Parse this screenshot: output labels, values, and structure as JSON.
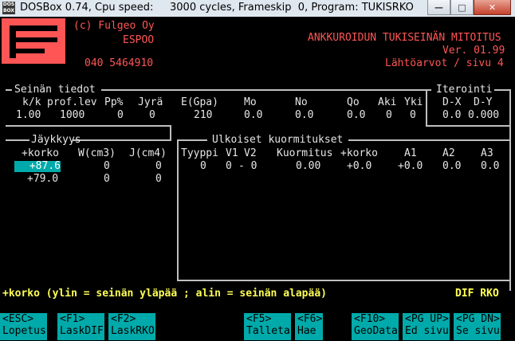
{
  "window": {
    "title": "DOSBox 0.74, Cpu speed:     3000 cycles, Frameskip  0, Program: TUKISRKO",
    "icon_text": "DOS BOX",
    "buttons": [
      "minimize-icon",
      "maximize-icon",
      "close-icon"
    ]
  },
  "header": {
    "company": "(c) Fulgeo Oy",
    "city": "ESPOO",
    "phone": "040 5464910",
    "app_title": "ANKKUROIDUN TUKISEINÄN MITOITUS",
    "version": "Ver. 01.99",
    "page_info": "Lähtöarvot / sivu 4"
  },
  "seinan": {
    "title": "Seinän tiedot",
    "headers": [
      "k/k",
      "prof.lev",
      "Pp%",
      "Jyrä",
      "E(Gpa)",
      "Mo",
      "No",
      "Qo",
      "Aki",
      "Yki"
    ],
    "values": [
      "1.00",
      "1000",
      "0",
      "0",
      "210",
      "0.0",
      "0.0",
      "0.0",
      "0",
      "0"
    ]
  },
  "iterointi": {
    "title": "Iterointi",
    "headers": [
      "D-X",
      "D-Y"
    ],
    "values": [
      "0.0",
      "0.000"
    ]
  },
  "jaykkyys": {
    "title": "Jäykkyys",
    "headers": [
      "+korko",
      "W(cm3)",
      "J(cm4)"
    ],
    "rows": [
      [
        "+87.6",
        "0",
        "0"
      ],
      [
        "+79.0",
        "0",
        "0"
      ]
    ]
  },
  "ulkoiset": {
    "title": "Ulkoiset kuormitukset",
    "headers": [
      "Tyyppi",
      "V1",
      "V2",
      "Kuormitus",
      "+korko",
      "A1",
      "A2",
      "A3"
    ],
    "row": [
      "0",
      "0",
      "- 0",
      "0.00",
      "+0.0",
      "+0.0",
      "0.0",
      "0.0"
    ]
  },
  "help_text": "+korko (ylin = seinän yläpää ; alin = seinän alapää)",
  "mode_text": "DIF RKO",
  "fkeys": [
    {
      "key": "<ESC>",
      "label": "Lopetus"
    },
    {
      "key": "<F1>",
      "label": "LaskDIF"
    },
    {
      "key": "<F2>",
      "label": "LaskRKO"
    },
    {
      "key": "<F5>",
      "label": "Talleta"
    },
    {
      "key": "<F6>",
      "label": "Hae"
    },
    {
      "key": "<F10>",
      "label": "GeoData"
    },
    {
      "key": "<PG UP>",
      "label": "Ed sivu"
    },
    {
      "key": "<PG DN>",
      "label": "Se sivu"
    }
  ]
}
